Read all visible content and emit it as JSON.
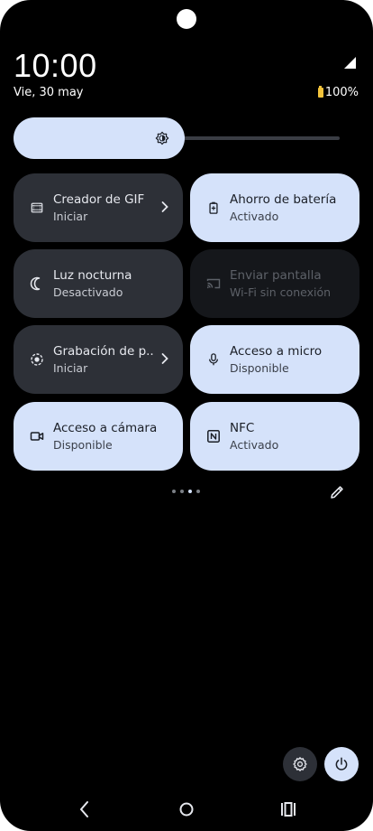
{
  "status": {
    "time": "10:00",
    "date": "Vie, 30 may",
    "battery": "100%"
  },
  "brightness": {
    "level": 0.5
  },
  "tiles": [
    {
      "title": "Creador de GIF",
      "subtitle": "Iniciar",
      "icon": "gif-icon",
      "state": "inactive",
      "chevron": true
    },
    {
      "title": "Ahorro de batería",
      "subtitle": "Activado",
      "icon": "battery-saver-icon",
      "state": "active",
      "chevron": false
    },
    {
      "title": "Luz nocturna",
      "subtitle": "Desactivado",
      "icon": "moon-icon",
      "state": "inactive",
      "chevron": false
    },
    {
      "title": "Enviar pantalla",
      "subtitle": "Wi-Fi sin conexión",
      "icon": "cast-icon",
      "state": "unavailable",
      "chevron": false
    },
    {
      "title": "Grabación de p..",
      "subtitle": "Iniciar",
      "icon": "screen-record-icon",
      "state": "inactive",
      "chevron": true
    },
    {
      "title": "Acceso a micro",
      "subtitle": "Disponible",
      "icon": "microphone-icon",
      "state": "active",
      "chevron": false
    },
    {
      "title": "Acceso a cámara",
      "subtitle": "Disponible",
      "icon": "camera-icon",
      "state": "active",
      "chevron": false
    },
    {
      "title": "NFC",
      "subtitle": "Activado",
      "icon": "nfc-icon",
      "state": "active",
      "chevron": false
    }
  ],
  "pager": {
    "pages": 4,
    "current": 3
  },
  "colors": {
    "accent": "#d5e2fa",
    "tile_dark": "#2d3037",
    "battery": "#f3c33b"
  }
}
